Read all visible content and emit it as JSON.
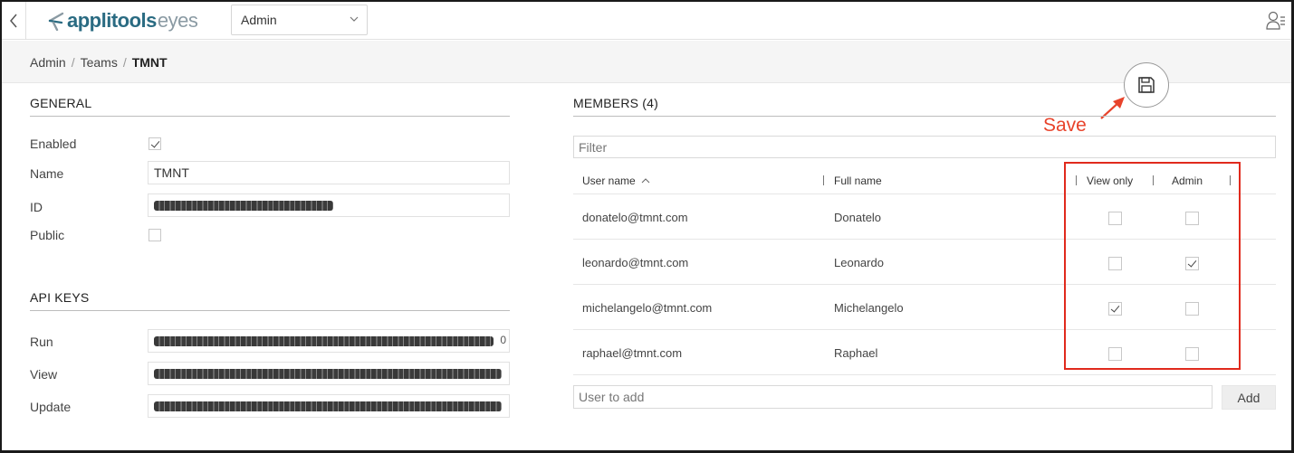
{
  "header": {
    "logo_primary": "applitools",
    "logo_secondary": "eyes",
    "context_select_value": "Admin"
  },
  "breadcrumb": [
    "Admin",
    "Teams",
    "TMNT"
  ],
  "breadcrumb_separator": "/",
  "general": {
    "title": "GENERAL",
    "enabled_label": "Enabled",
    "enabled": true,
    "name_label": "Name",
    "name_value": "TMNT",
    "id_label": "ID",
    "public_label": "Public",
    "public": false
  },
  "api_keys": {
    "title": "API KEYS",
    "run_label": "Run",
    "run_tail": "0",
    "view_label": "View",
    "update_label": "Update"
  },
  "members": {
    "title": "MEMBERS (4)",
    "filter_placeholder": "Filter",
    "columns": {
      "user_name": "User name",
      "full_name": "Full name",
      "view_only": "View only",
      "admin": "Admin"
    },
    "rows": [
      {
        "user": "donatelo@tmnt.com",
        "full": "Donatelo",
        "view_only": false,
        "admin": false
      },
      {
        "user": "leonardo@tmnt.com",
        "full": "Leonardo",
        "view_only": false,
        "admin": true
      },
      {
        "user": "michelangelo@tmnt.com",
        "full": "Michelangelo",
        "view_only": true,
        "admin": false
      },
      {
        "user": "raphael@tmnt.com",
        "full": "Raphael",
        "view_only": false,
        "admin": false
      }
    ],
    "add_placeholder": "User to add",
    "add_button": "Add"
  },
  "annotation": {
    "save_label": "Save",
    "color": "#e8432b"
  },
  "colors": {
    "brand_primary": "#2a6b82",
    "brand_secondary": "#8a9aa3",
    "highlight_box": "#e02a1d"
  },
  "icons": {
    "back": "chevron-left-icon",
    "select": "chevron-down-icon",
    "user_menu": "user-settings-icon",
    "save": "floppy-disk-icon",
    "sort": "sort-ascending-icon"
  }
}
